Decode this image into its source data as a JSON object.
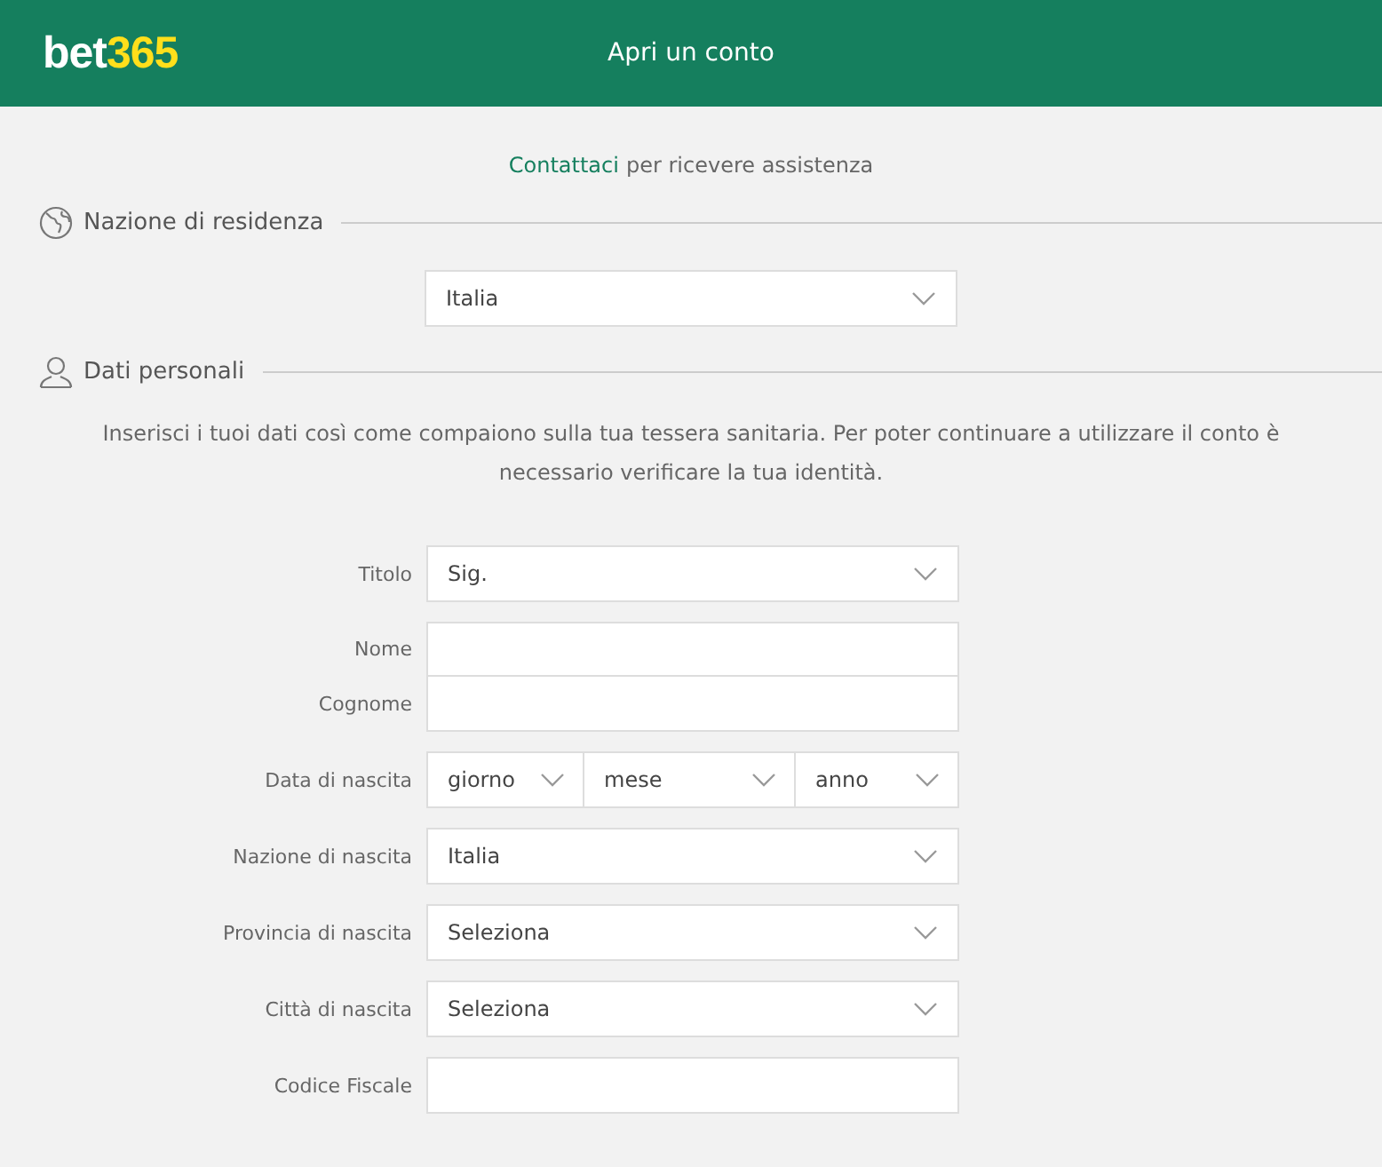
{
  "header": {
    "logo": {
      "part1": "bet",
      "part2": "365"
    },
    "title": "Apri un conto"
  },
  "contact": {
    "link": "Contattaci",
    "text": "per ricevere assistenza"
  },
  "residence": {
    "title": "Nazione di residenza",
    "value": "Italia"
  },
  "personal": {
    "title": "Dati personali",
    "intro": "Inserisci i tuoi dati così come compaiono sulla tua tessera sanitaria. Per poter continuare a utilizzare il conto è necessario verificare la tua identità.",
    "fields": [
      {
        "kind": "select",
        "label": "Titolo",
        "value": "Sig."
      },
      {
        "kind": "pair",
        "rows": [
          {
            "label": "Nome"
          },
          {
            "label": "Cognome"
          }
        ]
      },
      {
        "kind": "date",
        "label": "Data di nascita",
        "parts": [
          "giorno",
          "mese",
          "anno"
        ]
      },
      {
        "kind": "select",
        "label": "Nazione di nascita",
        "value": "Italia"
      },
      {
        "kind": "select",
        "label": "Provincia di nascita",
        "value": "Seleziona"
      },
      {
        "kind": "select",
        "label": "Città di nascita",
        "value": "Seleziona"
      },
      {
        "kind": "text",
        "label": "Codice Fiscale"
      }
    ]
  }
}
